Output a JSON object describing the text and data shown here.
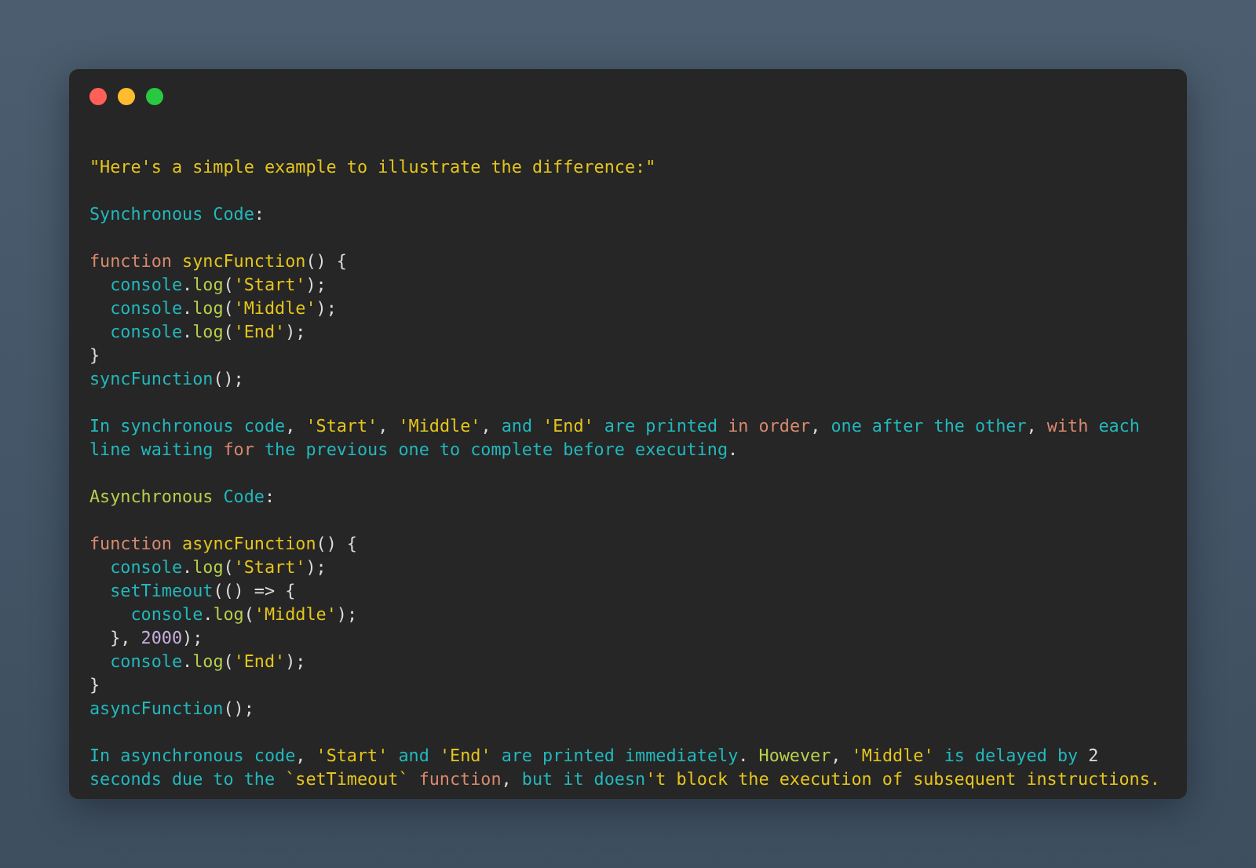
{
  "window": {
    "controls": [
      {
        "color": "#ff5f57"
      },
      {
        "color": "#febc2e"
      },
      {
        "color": "#28c840"
      }
    ]
  },
  "blocks": [
    {
      "lines": [
        [
          {
            "text": "\"Here's a simple example to illustrate the difference:\"",
            "kind": "string"
          }
        ]
      ]
    },
    {
      "lines": [
        [
          {
            "text": "Synchronous Code",
            "kind": "ident"
          },
          {
            "text": ":",
            "kind": "punct"
          }
        ]
      ]
    },
    {
      "lines": [
        [
          {
            "text": "function",
            "kind": "keyword"
          },
          {
            "text": " syncFunction",
            "kind": "string"
          },
          {
            "text": "() {",
            "kind": "punct"
          }
        ],
        [
          {
            "text": "  console",
            "kind": "ident"
          },
          {
            "text": ".",
            "kind": "punct"
          },
          {
            "text": "log",
            "kind": "label"
          },
          {
            "text": "(",
            "kind": "punct"
          },
          {
            "text": "'Start'",
            "kind": "string"
          },
          {
            "text": ");",
            "kind": "punct"
          }
        ],
        [
          {
            "text": "  console",
            "kind": "ident"
          },
          {
            "text": ".",
            "kind": "punct"
          },
          {
            "text": "log",
            "kind": "label"
          },
          {
            "text": "(",
            "kind": "punct"
          },
          {
            "text": "'Middle'",
            "kind": "string"
          },
          {
            "text": ");",
            "kind": "punct"
          }
        ],
        [
          {
            "text": "  console",
            "kind": "ident"
          },
          {
            "text": ".",
            "kind": "punct"
          },
          {
            "text": "log",
            "kind": "label"
          },
          {
            "text": "(",
            "kind": "punct"
          },
          {
            "text": "'End'",
            "kind": "string"
          },
          {
            "text": ");",
            "kind": "punct"
          }
        ],
        [
          {
            "text": "}",
            "kind": "punct"
          }
        ],
        [
          {
            "text": "syncFunction",
            "kind": "ident"
          },
          {
            "text": "();",
            "kind": "punct"
          }
        ]
      ]
    },
    {
      "lines": [
        [
          {
            "text": "In synchronous code",
            "kind": "ident"
          },
          {
            "text": ", ",
            "kind": "punct"
          },
          {
            "text": "'Start'",
            "kind": "string"
          },
          {
            "text": ", ",
            "kind": "punct"
          },
          {
            "text": "'Middle'",
            "kind": "string"
          },
          {
            "text": ", ",
            "kind": "punct"
          },
          {
            "text": "and ",
            "kind": "ident"
          },
          {
            "text": "'End'",
            "kind": "string"
          },
          {
            "text": " are printed ",
            "kind": "ident"
          },
          {
            "text": "in order",
            "kind": "keyword"
          },
          {
            "text": ", ",
            "kind": "punct"
          },
          {
            "text": "one after the other",
            "kind": "ident"
          },
          {
            "text": ", ",
            "kind": "punct"
          },
          {
            "text": "with",
            "kind": "keyword"
          },
          {
            "text": " each",
            "kind": "ident"
          }
        ],
        [
          {
            "text": "line waiting ",
            "kind": "ident"
          },
          {
            "text": "for",
            "kind": "keyword"
          },
          {
            "text": " the previous one to complete before executing",
            "kind": "ident"
          },
          {
            "text": ".",
            "kind": "punct"
          }
        ]
      ]
    },
    {
      "lines": [
        [
          {
            "text": "Asynchronous",
            "kind": "label"
          },
          {
            "text": " Code",
            "kind": "ident"
          },
          {
            "text": ":",
            "kind": "punct"
          }
        ]
      ]
    },
    {
      "lines": [
        [
          {
            "text": "function",
            "kind": "keyword"
          },
          {
            "text": " asyncFunction",
            "kind": "string"
          },
          {
            "text": "() {",
            "kind": "punct"
          }
        ],
        [
          {
            "text": "  console",
            "kind": "ident"
          },
          {
            "text": ".",
            "kind": "punct"
          },
          {
            "text": "log",
            "kind": "label"
          },
          {
            "text": "(",
            "kind": "punct"
          },
          {
            "text": "'Start'",
            "kind": "string"
          },
          {
            "text": ");",
            "kind": "punct"
          }
        ],
        [
          {
            "text": "  setTimeout",
            "kind": "ident"
          },
          {
            "text": "(() => {",
            "kind": "punct"
          }
        ],
        [
          {
            "text": "    console",
            "kind": "ident"
          },
          {
            "text": ".",
            "kind": "punct"
          },
          {
            "text": "log",
            "kind": "label"
          },
          {
            "text": "(",
            "kind": "punct"
          },
          {
            "text": "'Middle'",
            "kind": "string"
          },
          {
            "text": ");",
            "kind": "punct"
          }
        ],
        [
          {
            "text": "  }, ",
            "kind": "punct"
          },
          {
            "text": "2000",
            "kind": "number"
          },
          {
            "text": ");",
            "kind": "punct"
          }
        ],
        [
          {
            "text": "  console",
            "kind": "ident"
          },
          {
            "text": ".",
            "kind": "punct"
          },
          {
            "text": "log",
            "kind": "label"
          },
          {
            "text": "(",
            "kind": "punct"
          },
          {
            "text": "'End'",
            "kind": "string"
          },
          {
            "text": ");",
            "kind": "punct"
          }
        ],
        [
          {
            "text": "}",
            "kind": "punct"
          }
        ],
        [
          {
            "text": "asyncFunction",
            "kind": "ident"
          },
          {
            "text": "();",
            "kind": "punct"
          }
        ]
      ]
    },
    {
      "lines": [
        [
          {
            "text": "In asynchronous code",
            "kind": "ident"
          },
          {
            "text": ", ",
            "kind": "punct"
          },
          {
            "text": "'Start'",
            "kind": "string"
          },
          {
            "text": " and ",
            "kind": "ident"
          },
          {
            "text": "'End'",
            "kind": "string"
          },
          {
            "text": " are printed immediately",
            "kind": "ident"
          },
          {
            "text": ". ",
            "kind": "punct"
          },
          {
            "text": "However",
            "kind": "label"
          },
          {
            "text": ", ",
            "kind": "punct"
          },
          {
            "text": "'Middle'",
            "kind": "string"
          },
          {
            "text": " is delayed by ",
            "kind": "ident"
          },
          {
            "text": "2",
            "kind": "punct"
          }
        ],
        [
          {
            "text": "seconds due to the ",
            "kind": "ident"
          },
          {
            "text": "`setTimeout`",
            "kind": "string"
          },
          {
            "text": " function",
            "kind": "keyword"
          },
          {
            "text": ", ",
            "kind": "punct"
          },
          {
            "text": "but it doesn",
            "kind": "ident"
          },
          {
            "text": "'t block the execution of subsequent instructions.",
            "kind": "string"
          }
        ]
      ]
    }
  ]
}
